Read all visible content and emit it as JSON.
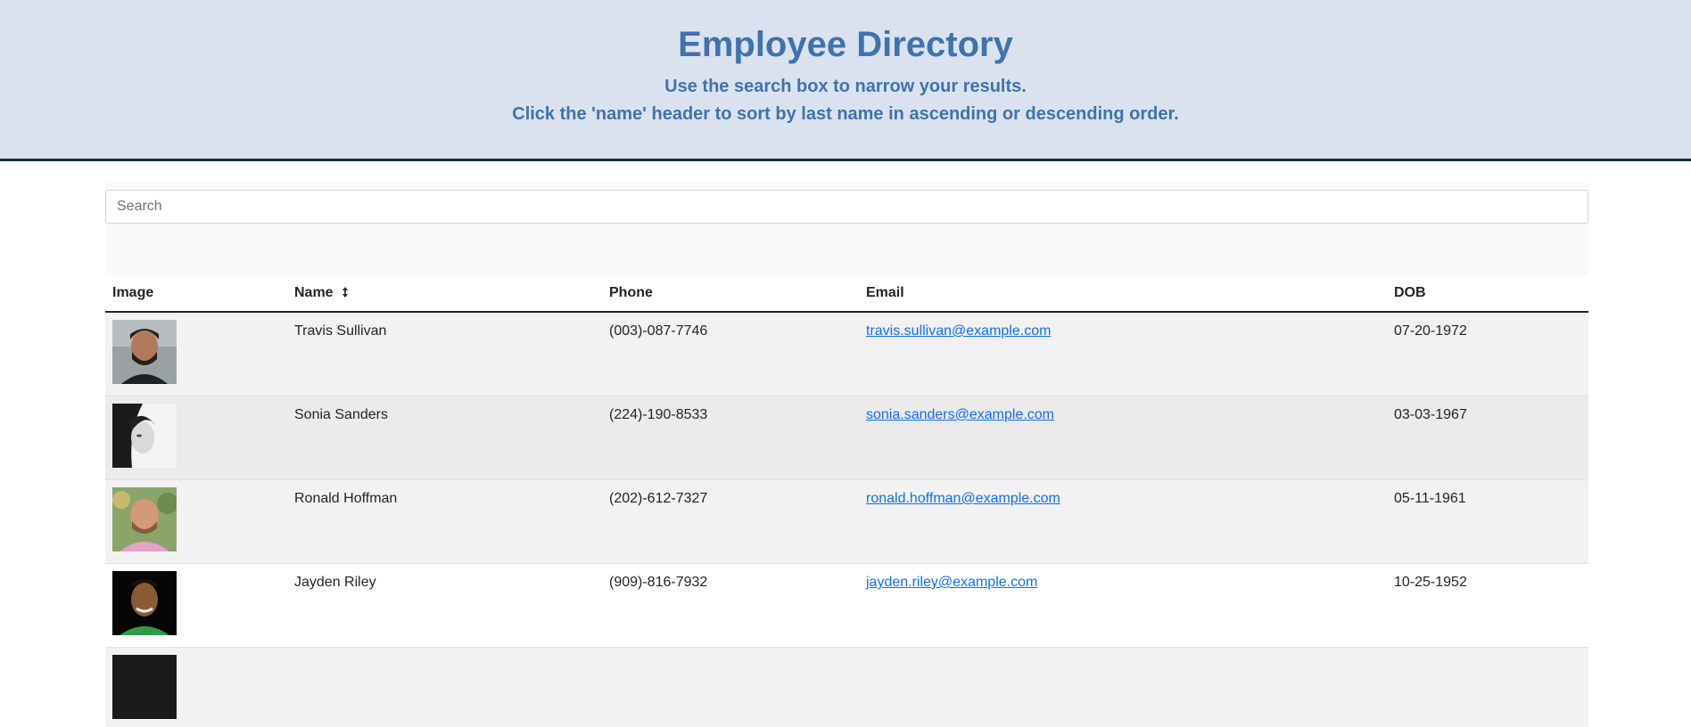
{
  "header": {
    "title": "Employee Directory",
    "subtitle1": "Use the search box to narrow your results.",
    "subtitle2": "Click the 'name' header to sort by last name in ascending or descending order."
  },
  "search": {
    "placeholder": "Search",
    "value": ""
  },
  "table": {
    "headers": {
      "image": "Image",
      "name": "Name",
      "phone": "Phone",
      "email": "Email",
      "dob": "DOB"
    },
    "rows": [
      {
        "name": "Travis Sullivan",
        "phone": "(003)-087-7746",
        "email": "travis.sullivan@example.com",
        "dob": "07-20-1972"
      },
      {
        "name": "Sonia Sanders",
        "phone": "(224)-190-8533",
        "email": "sonia.sanders@example.com",
        "dob": "03-03-1967"
      },
      {
        "name": "Ronald Hoffman",
        "phone": "(202)-612-7327",
        "email": "ronald.hoffman@example.com",
        "dob": "05-11-1961"
      },
      {
        "name": "Jayden Riley",
        "phone": "(909)-816-7932",
        "email": "jayden.riley@example.com",
        "dob": "10-25-1952"
      }
    ]
  },
  "colors": {
    "header_bg": "#dbe2ef",
    "header_text": "#3f72af",
    "header_border": "#112d4e",
    "link": "#0d6efd"
  }
}
